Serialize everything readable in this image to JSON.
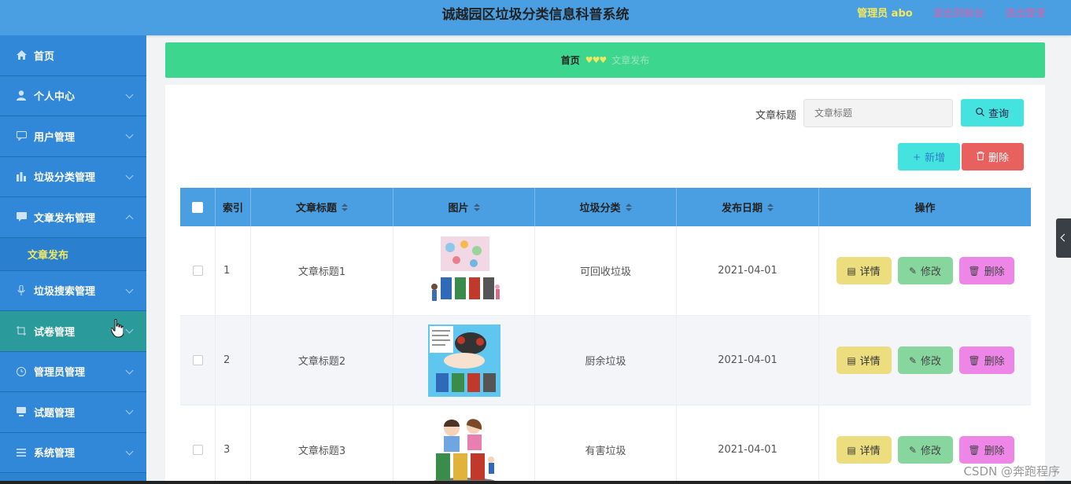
{
  "header": {
    "title": "诚越园区垃圾分类信息科普系统",
    "admin": "管理员 abo",
    "back_front": "退出到前台",
    "logout": "退出登录"
  },
  "sidebar": {
    "items": [
      {
        "label": "首页",
        "icon": "home-icon"
      },
      {
        "label": "个人中心",
        "icon": "user-icon"
      },
      {
        "label": "用户管理",
        "icon": "chat-icon"
      },
      {
        "label": "垃圾分类管理",
        "icon": "chart-icon"
      },
      {
        "label": "文章发布管理",
        "icon": "message-icon"
      },
      {
        "label": "垃圾搜索管理",
        "icon": "mic-icon"
      },
      {
        "label": "试卷管理",
        "icon": "crop-icon"
      },
      {
        "label": "管理员管理",
        "icon": "clock-icon"
      },
      {
        "label": "试题管理",
        "icon": "monitor-icon"
      },
      {
        "label": "系统管理",
        "icon": "menu-icon"
      }
    ],
    "submenu_active": "文章发布"
  },
  "breadcrumb": {
    "home": "首页",
    "current": "文章发布"
  },
  "search": {
    "label": "文章标题",
    "placeholder": "文章标题",
    "query_button": "查询",
    "add_button": "新增",
    "delete_button": "删除"
  },
  "table": {
    "columns": [
      "索引",
      "文章标题",
      "图片",
      "垃圾分类",
      "发布日期",
      "操作"
    ],
    "rows": [
      {
        "index": "1",
        "title": "文章标题1",
        "category": "可回收垃圾",
        "date": "2021-04-01"
      },
      {
        "index": "2",
        "title": "文章标题2",
        "category": "厨余垃圾",
        "date": "2021-04-01"
      },
      {
        "index": "3",
        "title": "文章标题3",
        "category": "有害垃圾",
        "date": "2021-04-01"
      }
    ],
    "actions": {
      "detail": "详情",
      "edit": "修改",
      "delete": "删除"
    }
  },
  "watermark": "CSDN @奔跑程序",
  "colors": {
    "header_bg": "#4a9fe3",
    "sidebar_bg": "#3288d8",
    "breadcrumb_bg": "#3dd68f",
    "accent_yellow": "#f2e85f",
    "link_pink": "#e45ba6"
  }
}
